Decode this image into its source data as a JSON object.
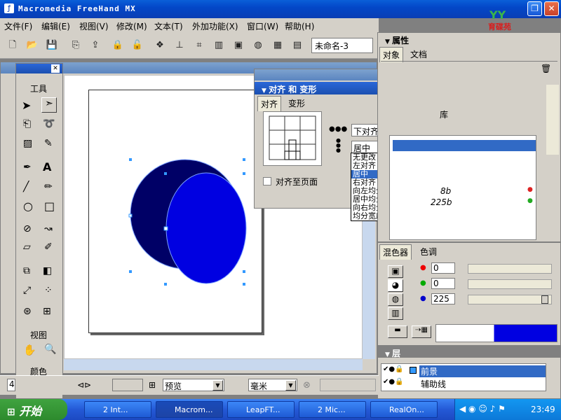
{
  "app": {
    "title": "Macromedia FreeHand MX",
    "logo_text": "育碟苑"
  },
  "menu": [
    "文件(F)",
    "编辑(E)",
    "视图(V)",
    "修改(M)",
    "文本(T)",
    "外加功能(X)",
    "窗口(W)",
    "帮助(H)"
  ],
  "document_selector": "未命名-3",
  "tools_panel": {
    "title": "工具",
    "view_label": "视图",
    "color_label": "颜色"
  },
  "align_dialog": {
    "title": "对齐 和 变形",
    "tabs": [
      "对齐",
      "变形"
    ],
    "vertical_select": "下对齐",
    "horizontal_select": "居中",
    "align_to_page": "对齐至页面",
    "dropdown_options": [
      "无更改",
      "左对齐",
      "居中",
      "右对齐",
      "向左均分",
      "居中均分",
      "向右均分",
      "均分宽度"
    ],
    "highlighted_option": "居中"
  },
  "properties_panel": {
    "title": "属性",
    "tabs": [
      "对象",
      "文档"
    ],
    "library_tab": "库",
    "row1": "8b",
    "row2": "225b"
  },
  "mixer_panel": {
    "tabs": [
      "混色器",
      "色调"
    ],
    "r": "0",
    "g": "0",
    "b": "225",
    "swatch_color": "#0000e1"
  },
  "layers_panel": {
    "title": "层",
    "layers": [
      "前景",
      "辅助线"
    ]
  },
  "statusbar": {
    "page": "4",
    "view_mode": "预览",
    "units": "毫米"
  },
  "taskbar": {
    "start": "开始",
    "tasks": [
      "2 Int...",
      "Macrom...",
      "LeapFT...",
      "2 Mic...",
      "RealOn..."
    ],
    "clock": "23:49"
  },
  "colors": {
    "ellipse_back": "#000066",
    "ellipse_front": "#0000e1",
    "accent": "#0a5fd8"
  }
}
